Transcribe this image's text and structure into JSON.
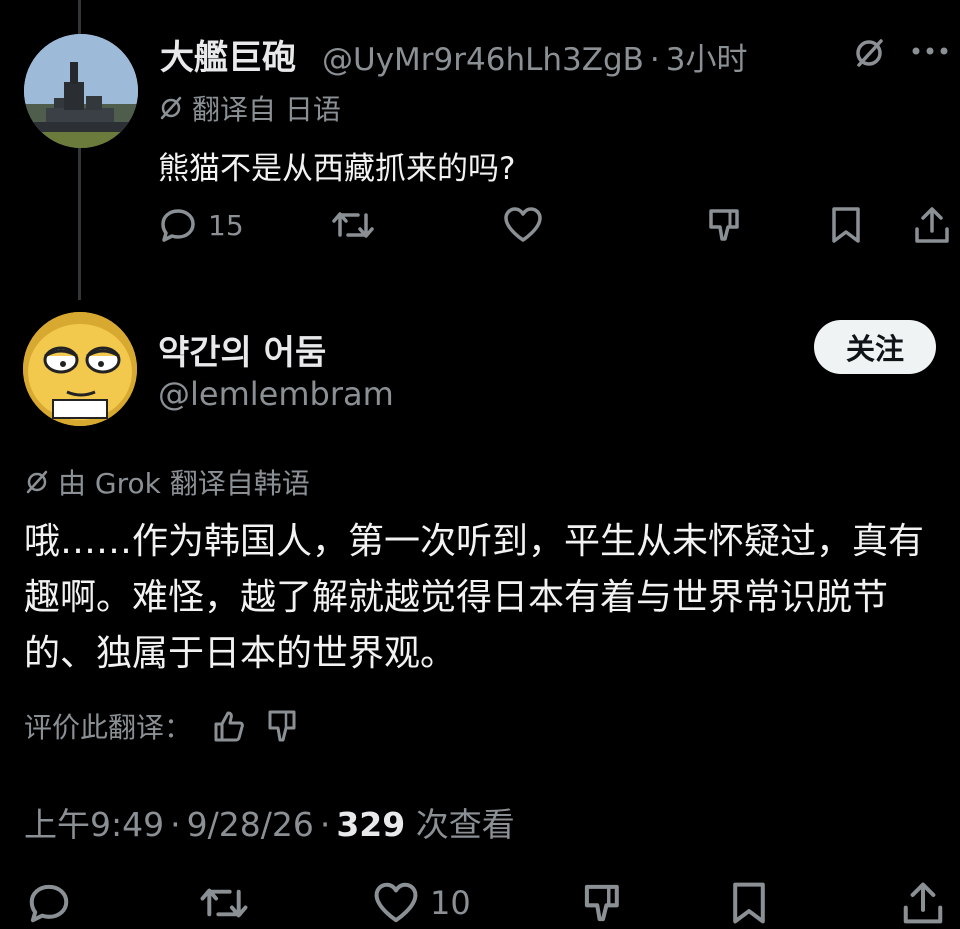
{
  "tweet1": {
    "display_name": "大艦巨砲",
    "handle": "@UyMr9r46hLh3ZgB",
    "time": "3小时",
    "translated_label": "翻译自 日语",
    "text": "熊猫不是从西藏抓来的吗?",
    "reply_count": "15"
  },
  "tweet2": {
    "display_name": "약간의 어둠",
    "handle": "@lemlembram",
    "follow_label": "关注",
    "translated_label": "由 Grok 翻译自韩语",
    "text": "哦……作为韩国人，第一次听到，平生从未怀疑过，真有趣啊。难怪，越了解就越觉得日本有着与世界常识脱节的、独属于日本的世界观。",
    "rate_label": "评价此翻译：",
    "time": "上午9:49",
    "date": "9/28/26",
    "views": "329",
    "views_label": "次查看",
    "like_count": "10"
  },
  "separator": "·",
  "icons": [
    "reply-icon",
    "retweet-icon",
    "like-icon",
    "dislike-icon",
    "bookmark-icon",
    "share-icon",
    "grok-slash-icon",
    "more-icon",
    "translate-icon",
    "thumbs-up-icon",
    "thumbs-down-icon"
  ],
  "colors": {
    "background": "#000000",
    "text": "#e7e9ea",
    "muted": "#8b9095",
    "button": "#eff3f4"
  }
}
